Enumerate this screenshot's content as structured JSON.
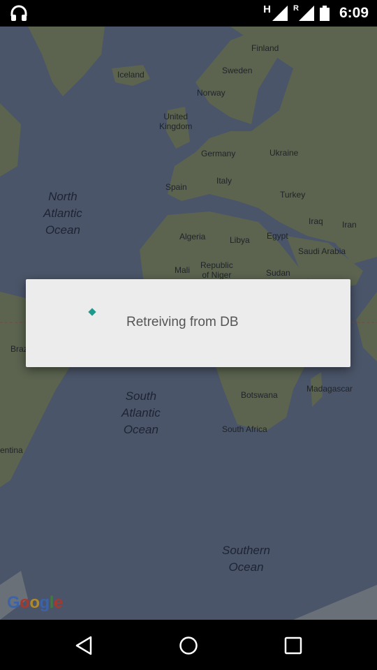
{
  "status_bar": {
    "time": "6:09",
    "network_label": "H",
    "roaming_label": "R",
    "icons": [
      "headphones-icon",
      "signal-icon",
      "roaming-signal-icon",
      "battery-icon"
    ]
  },
  "map": {
    "labels": {
      "finland": "Finland",
      "iceland": "Iceland",
      "sweden": "Sweden",
      "norway": "Norway",
      "united_kingdom": "United\nKingdom",
      "germany": "Germany",
      "ukraine": "Ukraine",
      "spain": "Spain",
      "italy": "Italy",
      "turkey": "Turkey",
      "iraq": "Iraq",
      "iran": "Iran",
      "algeria": "Algeria",
      "libya": "Libya",
      "egypt": "Egypt",
      "saudi_arabia": "Saudi Arabia",
      "mali": "Mali",
      "republic_of_niger": "Republic\nof Niger",
      "sudan": "Sudan",
      "brazil_partial": "Braz",
      "madagascar": "Madagascar",
      "botswana": "Botswana",
      "south_africa": "South Africa",
      "argentina_partial": "entina"
    },
    "oceans": {
      "north_atlantic": "North\nAtlantic\nOcean",
      "south_atlantic": "South\nAtlantic\nOcean",
      "southern": "Southern\nOcean"
    },
    "attribution": [
      "G",
      "o",
      "o",
      "g",
      "l",
      "e"
    ]
  },
  "dialog": {
    "message": "Retreiving from DB"
  },
  "nav_bar": {
    "icons": [
      "back-icon",
      "home-icon",
      "recents-icon"
    ]
  },
  "colors": {
    "ocean": "#4a5569",
    "land": "#5c6450",
    "dialog_bg": "#ececec",
    "spinner": "#1d9a8c"
  }
}
